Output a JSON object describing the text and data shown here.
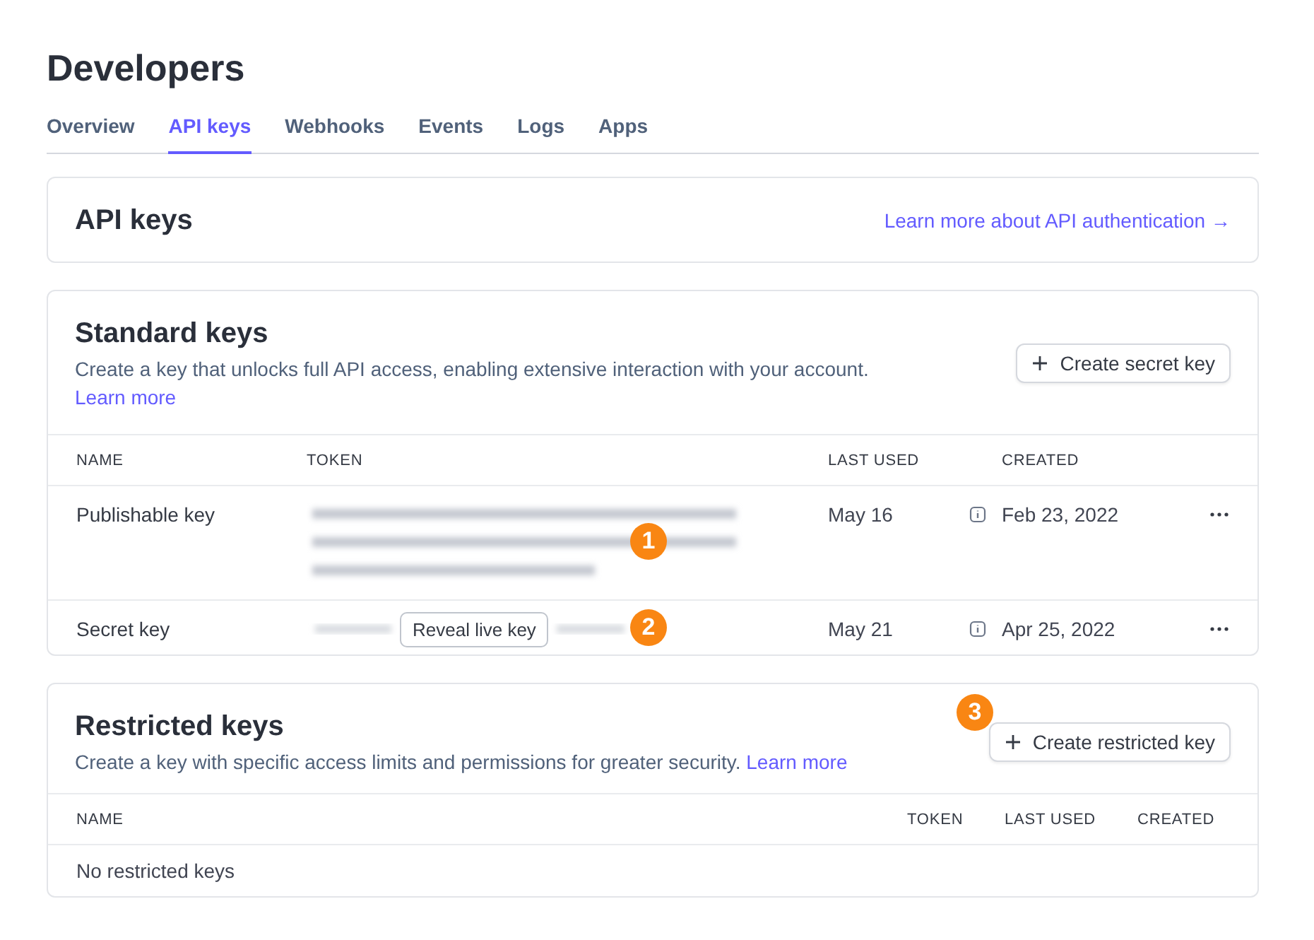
{
  "page_title": "Developers",
  "tabs": [
    {
      "label": "Overview",
      "selected": false
    },
    {
      "label": "API keys",
      "selected": true
    },
    {
      "label": "Webhooks",
      "selected": false
    },
    {
      "label": "Events",
      "selected": false
    },
    {
      "label": "Logs",
      "selected": false
    },
    {
      "label": "Apps",
      "selected": false
    }
  ],
  "header_card": {
    "title": "API keys",
    "link": "Learn more about API authentication →"
  },
  "standard_keys": {
    "title": "Standard keys",
    "description": "Create a key that unlocks full API access, enabling extensive interaction with your account.",
    "link": "Learn more",
    "button": "Create secret key",
    "columns": [
      "NAME",
      "TOKEN",
      "LAST USED",
      "CREATED"
    ],
    "rows": [
      {
        "name": "Publishable key",
        "kind": "publishable",
        "last_used": "May 16",
        "created": "Feb 23, 2022",
        "callout": "1"
      },
      {
        "name": "Secret key",
        "kind": "secret",
        "reveal_button": "Reveal live key",
        "last_used": "May 21",
        "created": "Apr 25, 2022",
        "callout": "2"
      }
    ]
  },
  "restricted_keys": {
    "title": "Restricted keys",
    "description": "Create a key with specific access limits and permissions for greater security.",
    "link": "Learn more",
    "button": "Create restricted key",
    "callout": "3",
    "columns": [
      "NAME",
      "TOKEN",
      "LAST USED",
      "CREATED"
    ],
    "empty_message": "No restricted keys"
  }
}
